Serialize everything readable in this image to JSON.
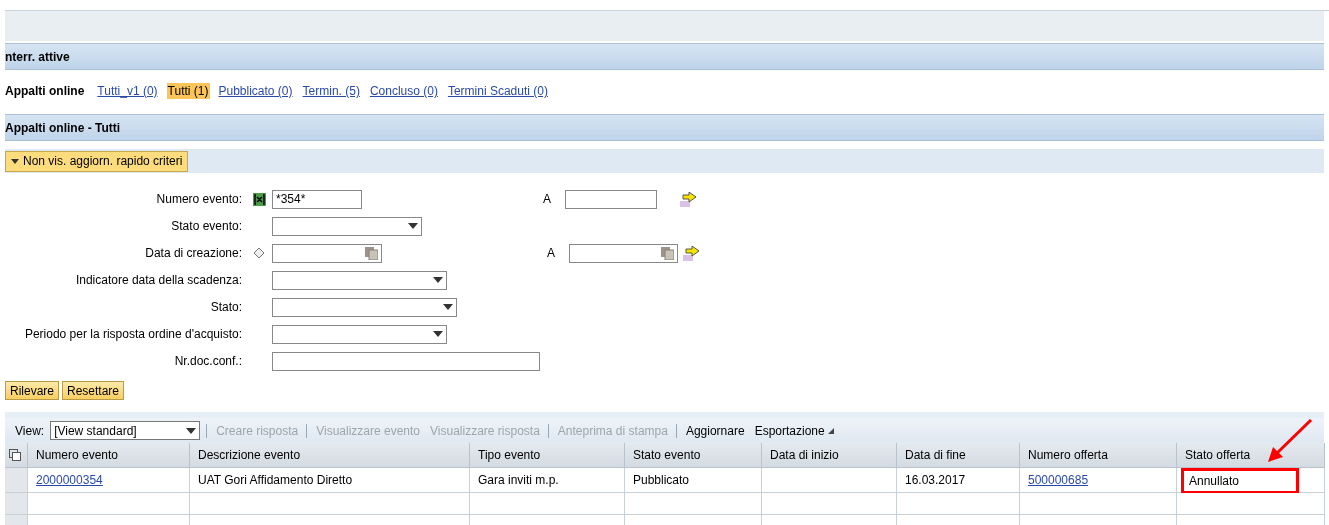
{
  "sections": {
    "active_queries": "nterr. attive",
    "results": "Appalti online - Tutti"
  },
  "query_bar": {
    "title": "Appalti online",
    "queries": [
      {
        "label": "Tutti_v1 (0)",
        "selected": false
      },
      {
        "label": "Tutti (1)",
        "selected": true
      },
      {
        "label": "Pubblicato (0)",
        "selected": false
      },
      {
        "label": "Termin. (5)",
        "selected": false
      },
      {
        "label": "Concluso (0)",
        "selected": false
      },
      {
        "label": "Termini Scaduti (0)",
        "selected": false
      }
    ]
  },
  "criteria_toggle": {
    "label": "Non vis. aggiorn. rapido criteri",
    "expanded": true
  },
  "fields": [
    {
      "label": "Numero evento:",
      "kind": "text",
      "value": "*354*",
      "operator": {
        "kind": "include"
      },
      "range_label": "A"
    },
    {
      "label": "Stato evento:",
      "kind": "select"
    },
    {
      "label": "Data di creazione:",
      "kind": "date",
      "operator": {
        "kind": "neutral"
      },
      "range_label": "A"
    },
    {
      "label": "Indicatore data della scadenza:",
      "kind": "select"
    },
    {
      "label": "Stato:",
      "kind": "select"
    },
    {
      "label": "Periodo per la risposta ordine d'acquisto:",
      "kind": "select"
    },
    {
      "label": "Nr.doc.conf.:",
      "kind": "text"
    }
  ],
  "form_buttons": [
    "Rilevare",
    "Resettare"
  ],
  "toolbar": {
    "view_label": "View:",
    "view_value": "[View standard]",
    "actions": [
      {
        "label": "Creare risposta",
        "disabled": true,
        "separator_before": true,
        "menu": false
      },
      {
        "label": "Visualizzare evento",
        "disabled": true,
        "separator_before": true,
        "menu": false
      },
      {
        "label": "Visualizzare risposta",
        "disabled": true,
        "separator_before": false,
        "menu": false
      },
      {
        "label": "Anteprima di stampa",
        "disabled": true,
        "separator_before": true,
        "menu": false
      },
      {
        "label": "Aggiornare",
        "disabled": false,
        "separator_before": true,
        "menu": false
      },
      {
        "label": "Esportazione",
        "disabled": false,
        "separator_before": false,
        "menu": true
      }
    ]
  },
  "table": {
    "columns": [
      "Numero evento",
      "Descrizione evento",
      "Tipo evento",
      "Stato evento",
      "Data di inizio",
      "Data di fine",
      "Numero offerta",
      "Stato offerta"
    ],
    "rows": [
      {
        "cells": [
          {
            "text": "2000000354",
            "kind": "link",
            "highlighted": false
          },
          {
            "text": "UAT Gori Affidamento Diretto",
            "kind": "text",
            "highlighted": false
          },
          {
            "text": "Gara inviti m.p.",
            "kind": "text",
            "highlighted": false
          },
          {
            "text": "Pubblicato",
            "kind": "text",
            "highlighted": false
          },
          {
            "text": "",
            "kind": "text",
            "highlighted": false
          },
          {
            "text": "16.03.2017",
            "kind": "text",
            "highlighted": false
          },
          {
            "text": "500000685",
            "kind": "link",
            "highlighted": false
          },
          {
            "text": "Annullato",
            "kind": "text",
            "highlighted": true
          }
        ]
      }
    ]
  }
}
